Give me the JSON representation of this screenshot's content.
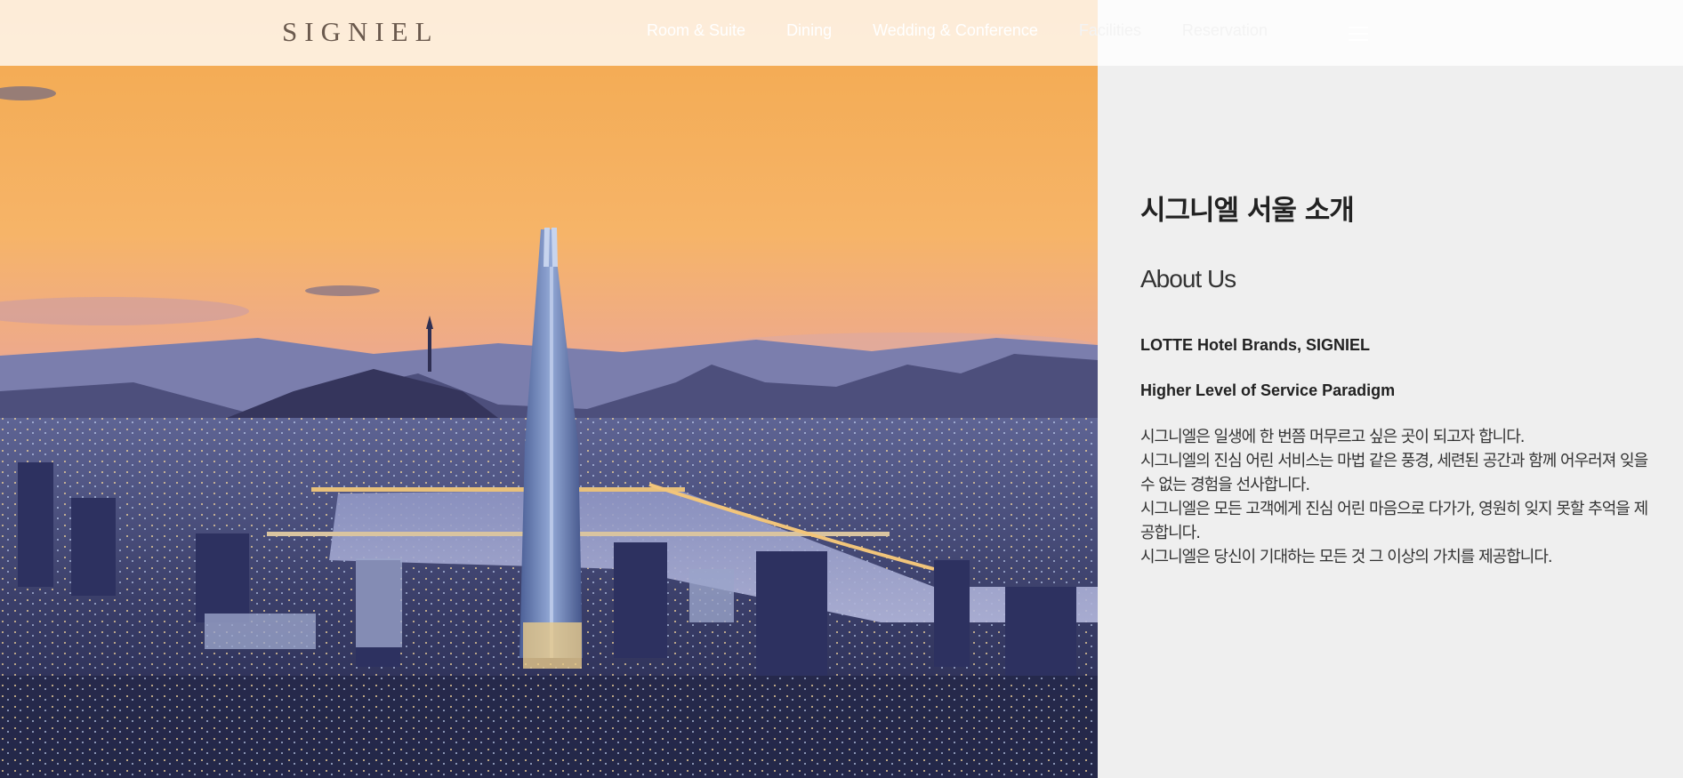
{
  "header": {
    "logo": "SIGNIEL",
    "nav": [
      "Room & Suite",
      "Dining",
      "Wedding & Conference",
      "Facilities",
      "Reservation"
    ],
    "menu_icon": "hamburger-menu-icon"
  },
  "hero": {
    "image": "seoul-skyline-sunset-lotte-world-tower"
  },
  "about": {
    "title_ko": "시그니엘 서울 소개",
    "title_en": "About Us",
    "subheading_1": "LOTTE Hotel Brands, SIGNIEL",
    "subheading_2": "Higher Level of Service Paradigm",
    "paragraphs": [
      "시그니엘은 일생에 한 번쯤 머무르고 싶은 곳이 되고자 합니다.",
      "시그니엘의 진심 어린 서비스는 마법 같은 풍경, 세련된 공간과 함께 어우러져 잊을 수 없는 경험을 선사합니다.",
      "시그니엘은 모든 고객에게 진심 어린 마음으로 다가가, 영원히 잊지 못할 추억을 제공합니다.",
      "시그니엘은 당신이 기대하는 모든 것 그 이상의 가치를 제공합니다."
    ]
  },
  "colors": {
    "panel_bg": "#efefef",
    "logo": "#6b5a4e",
    "text": "#222222"
  }
}
